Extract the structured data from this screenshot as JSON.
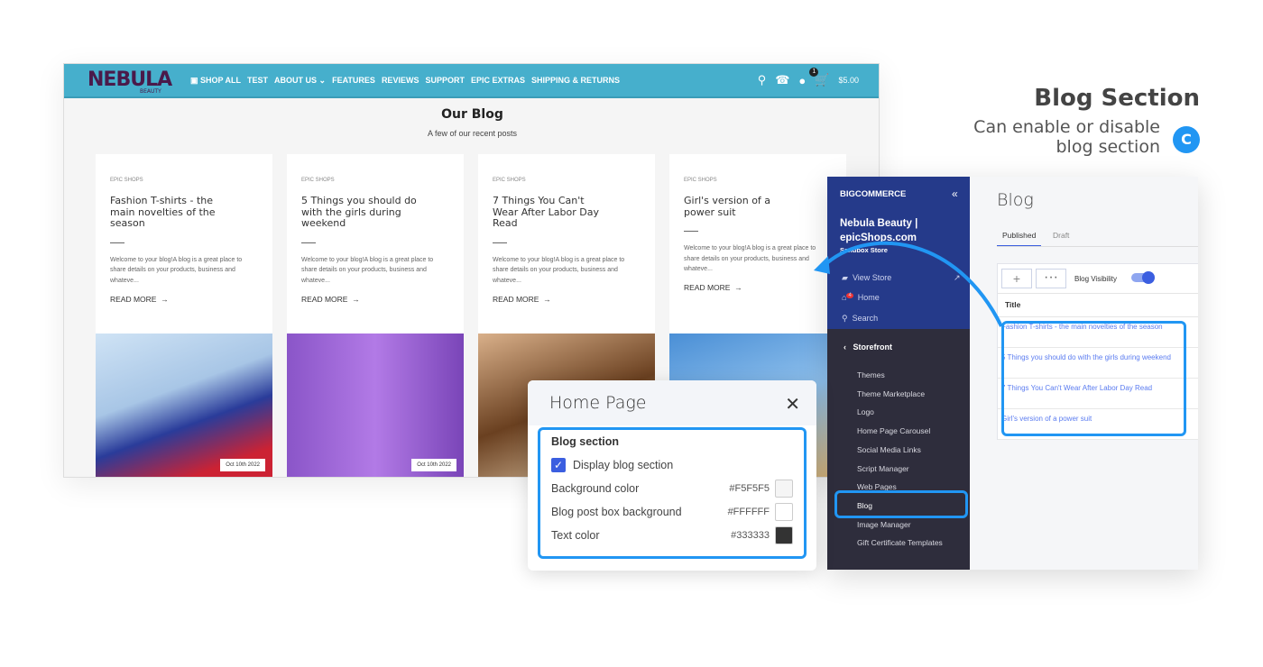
{
  "store": {
    "logo": "NEBULA",
    "logo_sub": "BEAUTY",
    "nav": [
      "SHOP ALL",
      "TEST",
      "ABOUT US ⌄",
      "FEATURES",
      "REVIEWS",
      "SUPPORT",
      "EPIC EXTRAS",
      "SHIPPING & RETURNS"
    ],
    "cart_count": "1",
    "cart_total": "$5.00",
    "heading": "Our Blog",
    "subheading": "A few of our recent posts",
    "posts": [
      {
        "category": "EPIC SHOPS",
        "title": "Fashion T-shirts - the main novelties of the season",
        "excerpt": "Welcome to your blog!A blog is a great place to share details on your products, business and whateve...",
        "read_more": "READ MORE",
        "date": "Oct 10th 2022"
      },
      {
        "category": "EPIC SHOPS",
        "title": "5 Things you should do with the girls during weekend",
        "excerpt": "Welcome to your blog!A blog is a great place to share details on your products, business and whateve...",
        "read_more": "READ MORE",
        "date": "Oct 10th 2022"
      },
      {
        "category": "EPIC SHOPS",
        "title": "7 Things You Can't Wear After Labor Day Read",
        "excerpt": "Welcome to your blog!A blog is a great place to share details on your products, business and whateve...",
        "read_more": "READ MORE",
        "date": ""
      },
      {
        "category": "EPIC SHOPS",
        "title": "Girl's version of a power suit",
        "excerpt": "Welcome to your blog!A blog is a great place to share details on your products, business and whateve...",
        "read_more": "READ MORE",
        "date": ""
      }
    ]
  },
  "callout": {
    "title": "Blog Section",
    "desc1": "Can enable or disable",
    "desc2": "blog section",
    "badge": "C",
    "accent": "#2196f3"
  },
  "modal": {
    "title": "Home Page",
    "section": "Blog section",
    "display_label": "Display blog section",
    "display_checked": true,
    "colors": [
      {
        "label": "Background color",
        "hex": "#F5F5F5"
      },
      {
        "label": "Blog post box background",
        "hex": "#FFFFFF"
      },
      {
        "label": "Text color",
        "hex": "#333333"
      }
    ]
  },
  "admin": {
    "brand": "BIGCOMMERCE",
    "store_name1": "Nebula Beauty |",
    "store_name2": "epicShops.com",
    "store_type": "Sandbox Store",
    "view_store": "View Store",
    "home": "Home",
    "home_badge": "4",
    "search": "Search",
    "section": "Storefront",
    "menu": [
      "Themes",
      "Theme Marketplace",
      "Logo",
      "Home Page Carousel",
      "Social Media Links",
      "Script Manager",
      "Web Pages",
      "Blog",
      "Image Manager",
      "Gift Certificate Templates"
    ],
    "active": "Blog",
    "page_title": "Blog",
    "tabs": [
      "Published",
      "Draft"
    ],
    "visibility_label": "Blog Visibility",
    "visibility_on": true,
    "column": "Title",
    "posts": [
      "Fashion T-shirts - the main novelties of the season",
      "5 Things you should do with the girls during weekend",
      "7 Things You Can't Wear After Labor Day Read",
      "Girl's version of a power suit"
    ]
  }
}
